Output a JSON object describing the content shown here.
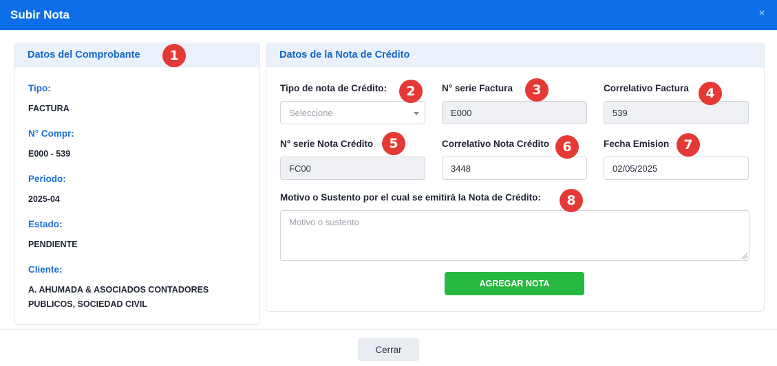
{
  "modal": {
    "title": "Subir Nota",
    "close_icon": "×"
  },
  "left_card": {
    "title": "Datos del Comprobante",
    "fields": [
      {
        "label": "Tipo:",
        "value": "FACTURA"
      },
      {
        "label": "N° Compr:",
        "value": "E000 - 539"
      },
      {
        "label": "Periodo:",
        "value": "2025-04"
      },
      {
        "label": "Estado:",
        "value": "PENDIENTE"
      },
      {
        "label": "Cliente:",
        "value_line1": "A. AHUMADA & ASOCIADOS CONTADORES",
        "value_line2": "PUBLICOS, SOCIEDAD CIVIL"
      }
    ]
  },
  "right_card": {
    "title": "Datos de la Nota de Crédito",
    "tipo_nota": {
      "label": "Tipo de nota de Crédito:",
      "selected": "Seleccione"
    },
    "serie_factura": {
      "label": "N° serie Factura",
      "value": "E000"
    },
    "correlativo_factura": {
      "label": "Correlativo Factura",
      "value": "539"
    },
    "serie_nota": {
      "label": "N° serie Nota Crédito",
      "value": "FC00"
    },
    "correlativo_nota": {
      "label": "Correlativo Nota Crédito",
      "value": "3448"
    },
    "fecha_emision": {
      "label": "Fecha Emision",
      "value": "02/05/2025"
    },
    "motivo": {
      "label": "Motivo o Sustento por el cual se emitirá la Nota de Crédito:",
      "placeholder": "Motivo o sustento"
    },
    "add_button": "AGREGAR NOTA"
  },
  "footer": {
    "close_button": "Cerrar"
  },
  "badges": [
    "1",
    "2",
    "3",
    "4",
    "5",
    "6",
    "7",
    "8"
  ],
  "colors": {
    "header": "#0d6ee8",
    "accent": "#1565c8",
    "success": "#27b83f",
    "badge": "#e53935"
  }
}
